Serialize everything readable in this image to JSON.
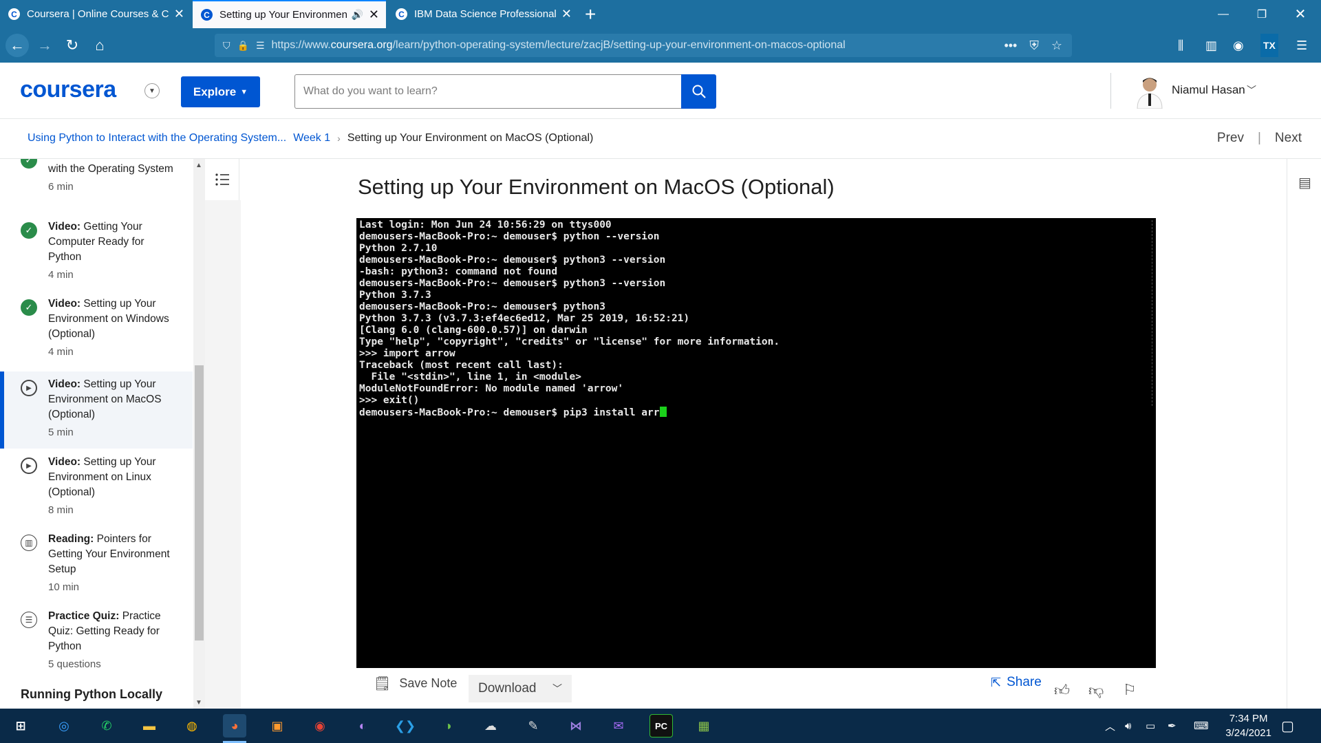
{
  "browser": {
    "tabs": [
      {
        "title": "Coursera | Online Courses & Cr",
        "active": false
      },
      {
        "title": "Setting up Your Environmen",
        "active": true
      },
      {
        "title": "IBM Data Science Professional",
        "active": false
      }
    ],
    "url_prefix": "https://www.",
    "url_domain": "coursera.org",
    "url_path": "/learn/python-operating-system/lecture/zacjB/setting-up-your-environment-on-macos-optional"
  },
  "header": {
    "logo": "coursera",
    "explore_label": "Explore",
    "search_placeholder": "What do you want to learn?",
    "user_name": "Niamul Hasan"
  },
  "breadcrumb": {
    "course": "Using Python to Interact with the Operating System...",
    "week": "Week 1",
    "current": "Setting up Your Environment on MacOS (Optional)",
    "prev": "Prev",
    "next": "Next"
  },
  "sidebar": {
    "items": [
      {
        "type_label": "",
        "title": "with the Operating System",
        "duration": "6 min",
        "status": "done"
      },
      {
        "type_label": "Video:",
        "title": "Getting Your Computer Ready for Python",
        "duration": "4 min",
        "status": "done"
      },
      {
        "type_label": "Video:",
        "title": "Setting up Your Environment on Windows (Optional)",
        "duration": "4 min",
        "status": "done"
      },
      {
        "type_label": "Video:",
        "title": "Setting up Your Environment on MacOS (Optional)",
        "duration": "5 min",
        "status": "current"
      },
      {
        "type_label": "Video:",
        "title": "Setting up Your Environment on Linux (Optional)",
        "duration": "8 min",
        "status": "play"
      },
      {
        "type_label": "Reading:",
        "title": "Pointers for Getting Your Environment Setup",
        "duration": "10 min",
        "status": "reading"
      },
      {
        "type_label": "Practice Quiz:",
        "title": "Practice Quiz: Getting Ready for Python",
        "duration": "5 questions",
        "status": "quiz"
      }
    ],
    "section_heading": "Running Python Locally"
  },
  "main": {
    "title": "Setting up Your Environment on MacOS (Optional)",
    "terminal_lines": [
      "Last login: Mon Jun 24 10:56:29 on ttys000",
      "demousers-MacBook-Pro:~ demouser$ python --version",
      "Python 2.7.10",
      "demousers-MacBook-Pro:~ demouser$ python3 --version",
      "-bash: python3: command not found",
      "demousers-MacBook-Pro:~ demouser$ python3 --version",
      "Python 3.7.3",
      "demousers-MacBook-Pro:~ demouser$ python3",
      "Python 3.7.3 (v3.7.3:ef4ec6ed12, Mar 25 2019, 16:52:21)",
      "[Clang 6.0 (clang-600.0.57)] on darwin",
      "Type \"help\", \"copyright\", \"credits\" or \"license\" for more information.",
      ">>> import arrow",
      "Traceback (most recent call last):",
      "  File \"<stdin>\", line 1, in <module>",
      "ModuleNotFoundError: No module named 'arrow'",
      ">>> exit()"
    ],
    "terminal_last_line": "demousers-MacBook-Pro:~ demouser$ pip3 install arr",
    "save_note": "Save Note",
    "download": "Download",
    "share": "Share"
  },
  "taskbar": {
    "time": "7:34 PM",
    "date": "3/24/2021"
  },
  "colors": {
    "brand": "#0056d2",
    "browser_chrome": "#1d6fa0",
    "done_green": "#2a8c4a",
    "cursor_green": "#1bd11b",
    "taskbar": "#0a2a48"
  }
}
